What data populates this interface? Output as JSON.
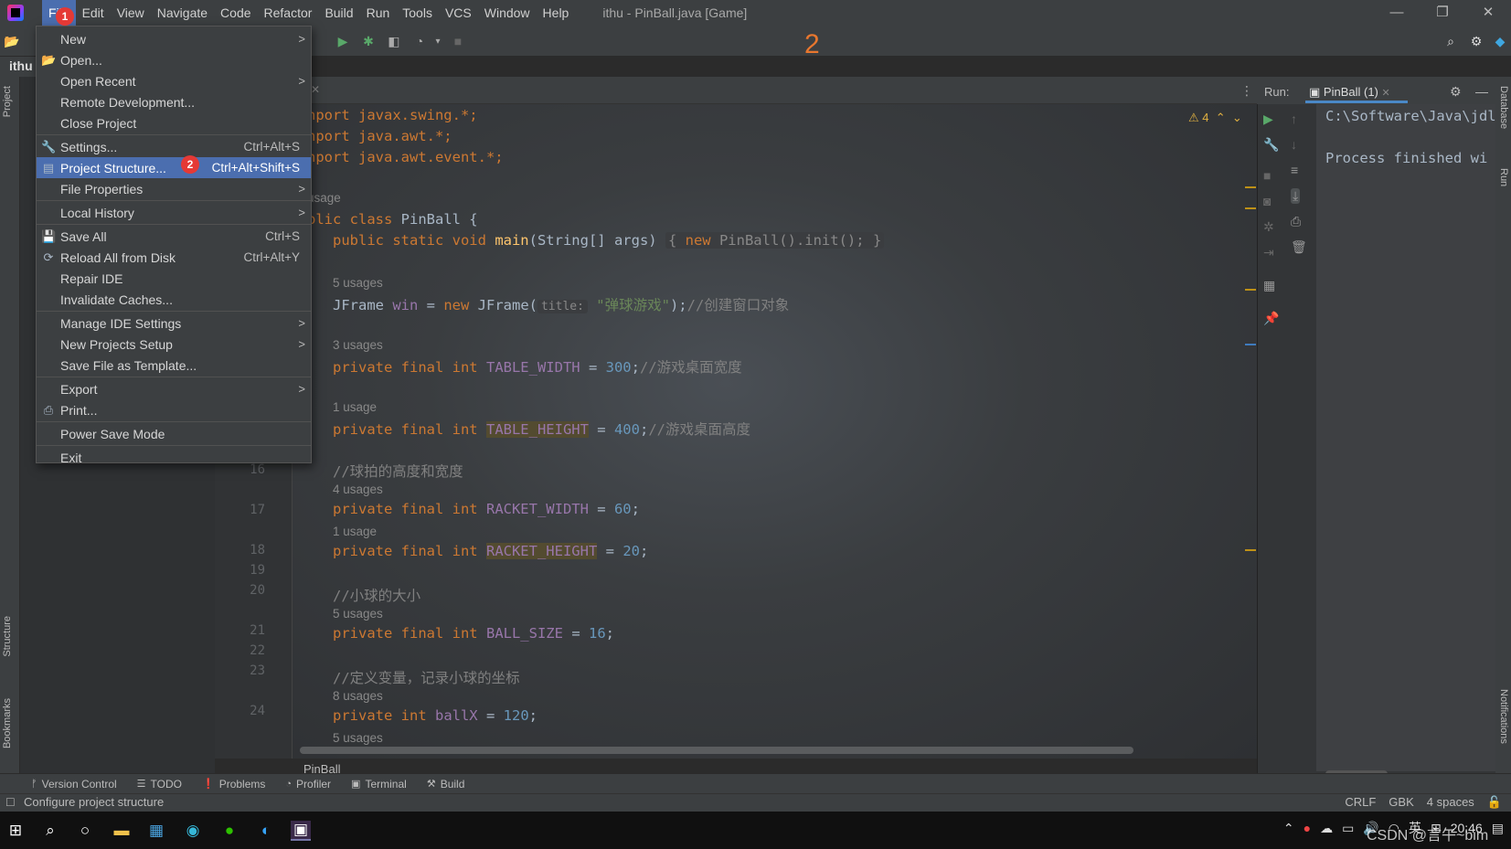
{
  "app": {
    "window_title": "ithu - PinBall.java [Game]",
    "menu": [
      "File",
      "Edit",
      "View",
      "Navigate",
      "Code",
      "Refactor",
      "Build",
      "Run",
      "Tools",
      "VCS",
      "Window",
      "Help"
    ],
    "project_name": "ithu",
    "step_marker": "2",
    "badge_1": "1",
    "badge_2": "2"
  },
  "file_menu": {
    "items": [
      {
        "label": "New",
        "submenu": ">"
      },
      {
        "label": "Open...",
        "icon": "folder-icon"
      },
      {
        "label": "Open Recent",
        "submenu": ">"
      },
      {
        "label": "Remote Development..."
      },
      {
        "label": "Close Project"
      },
      {
        "label": "Settings...",
        "shortcut": "Ctrl+Alt+S",
        "icon": "wrench-icon"
      },
      {
        "label": "Project Structure...",
        "shortcut": "Ctrl+Alt+Shift+S",
        "icon": "folder-structure-icon",
        "selected": true
      },
      {
        "label": "File Properties",
        "submenu": ">"
      },
      {
        "label": "Local History",
        "submenu": ">"
      },
      {
        "label": "Save All",
        "shortcut": "Ctrl+S",
        "icon": "save-icon"
      },
      {
        "label": "Reload All from Disk",
        "shortcut": "Ctrl+Alt+Y",
        "icon": "reload-icon"
      },
      {
        "label": "Repair IDE"
      },
      {
        "label": "Invalidate Caches..."
      },
      {
        "label": "Manage IDE Settings",
        "submenu": ">"
      },
      {
        "label": "New Projects Setup",
        "submenu": ">"
      },
      {
        "label": "Save File as Template..."
      },
      {
        "label": "Export",
        "submenu": ">"
      },
      {
        "label": "Print...",
        "icon": "print-icon"
      },
      {
        "label": "Power Save Mode"
      },
      {
        "label": "Exit"
      }
    ]
  },
  "editor": {
    "warning_count": "4",
    "breadcrumb": "PinBall",
    "line_numbers": [
      "16",
      "17",
      "18",
      "19",
      "20",
      "21",
      "22",
      "23",
      "24"
    ],
    "lines": {
      "import1": "nport javax.swing.*;",
      "import2": "nport java.awt.*;",
      "import3": "nport java.awt.event.*;",
      "usage_class": "usage",
      "class_decl_kw": "blic class ",
      "class_decl_name": "PinBall {",
      "main_a": "public static void ",
      "main_b": "main",
      "main_c": "(String[] args) ",
      "main_d": "{ ",
      "main_e": "new ",
      "main_f": "PinBall().init(); ",
      "main_g": "}",
      "usages_5": "5 usages",
      "jframe_a": "JFrame ",
      "jframe_b": "win",
      "jframe_c": " = ",
      "jframe_d": "new ",
      "jframe_e": "JFrame(",
      "jframe_hint": "title:",
      "jframe_str": "\"弹球游戏\"",
      "jframe_end": ");",
      "jframe_cmt": "//创建窗口对象",
      "usages_3": "3 usages",
      "tw_a": "private final int ",
      "tw_b": "TABLE_WIDTH",
      "tw_c": " = ",
      "tw_d": "300",
      "tw_e": ";",
      "tw_cmt": "//游戏桌面宽度",
      "usage_1a": "1 usage",
      "th_a": "private final int ",
      "th_b": "TABLE_HEIGHT",
      "th_c": " = ",
      "th_d": "400",
      "th_e": ";",
      "th_cmt": "//游戏桌面高度",
      "cmt_racket": "//球拍的高度和宽度",
      "usages_4": "4 usages",
      "rw_a": "private final int ",
      "rw_b": "RACKET_WIDTH",
      "rw_c": " = ",
      "rw_d": "60",
      "rw_e": ";",
      "usage_1b": "1 usage",
      "rh_a": "private final int ",
      "rh_b": "RACKET_HEIGHT",
      "rh_c": " = ",
      "rh_d": "20",
      "rh_e": ";",
      "cmt_ball": "//小球的大小",
      "usages_5b": "5 usages",
      "bs_a": "private final int ",
      "bs_b": "BALL_SIZE",
      "bs_c": " = ",
      "bs_d": "16",
      "bs_e": ";",
      "cmt_vars": "//定义变量，记录小球的坐标",
      "usages_8": "8 usages",
      "bx_a": "private int ",
      "bx_b": "ballX",
      "bx_c": " = ",
      "bx_d": "120",
      "bx_e": ";",
      "usages_5c": "5 usages"
    }
  },
  "run_panel": {
    "label": "Run:",
    "tab": "PinBall (1)",
    "console_line_1": "C:\\Software\\Java\\jdl",
    "console_line_2": "Process finished wi"
  },
  "side_tabs": {
    "project": "Project",
    "structure": "Structure",
    "bookmarks": "Bookmarks",
    "database": "Database",
    "run": "Run",
    "notifications": "Notifications"
  },
  "bottom_bar": [
    "Version Control",
    "TODO",
    "Problems",
    "Profiler",
    "Terminal",
    "Build"
  ],
  "status": {
    "text": "Configure project structure",
    "line_sep": "CRLF",
    "encoding": "GBK",
    "indent": "4 spaces"
  },
  "taskbar": {
    "ime": "英",
    "time": "20:46",
    "watermark": "CSDN @言午~bim"
  }
}
